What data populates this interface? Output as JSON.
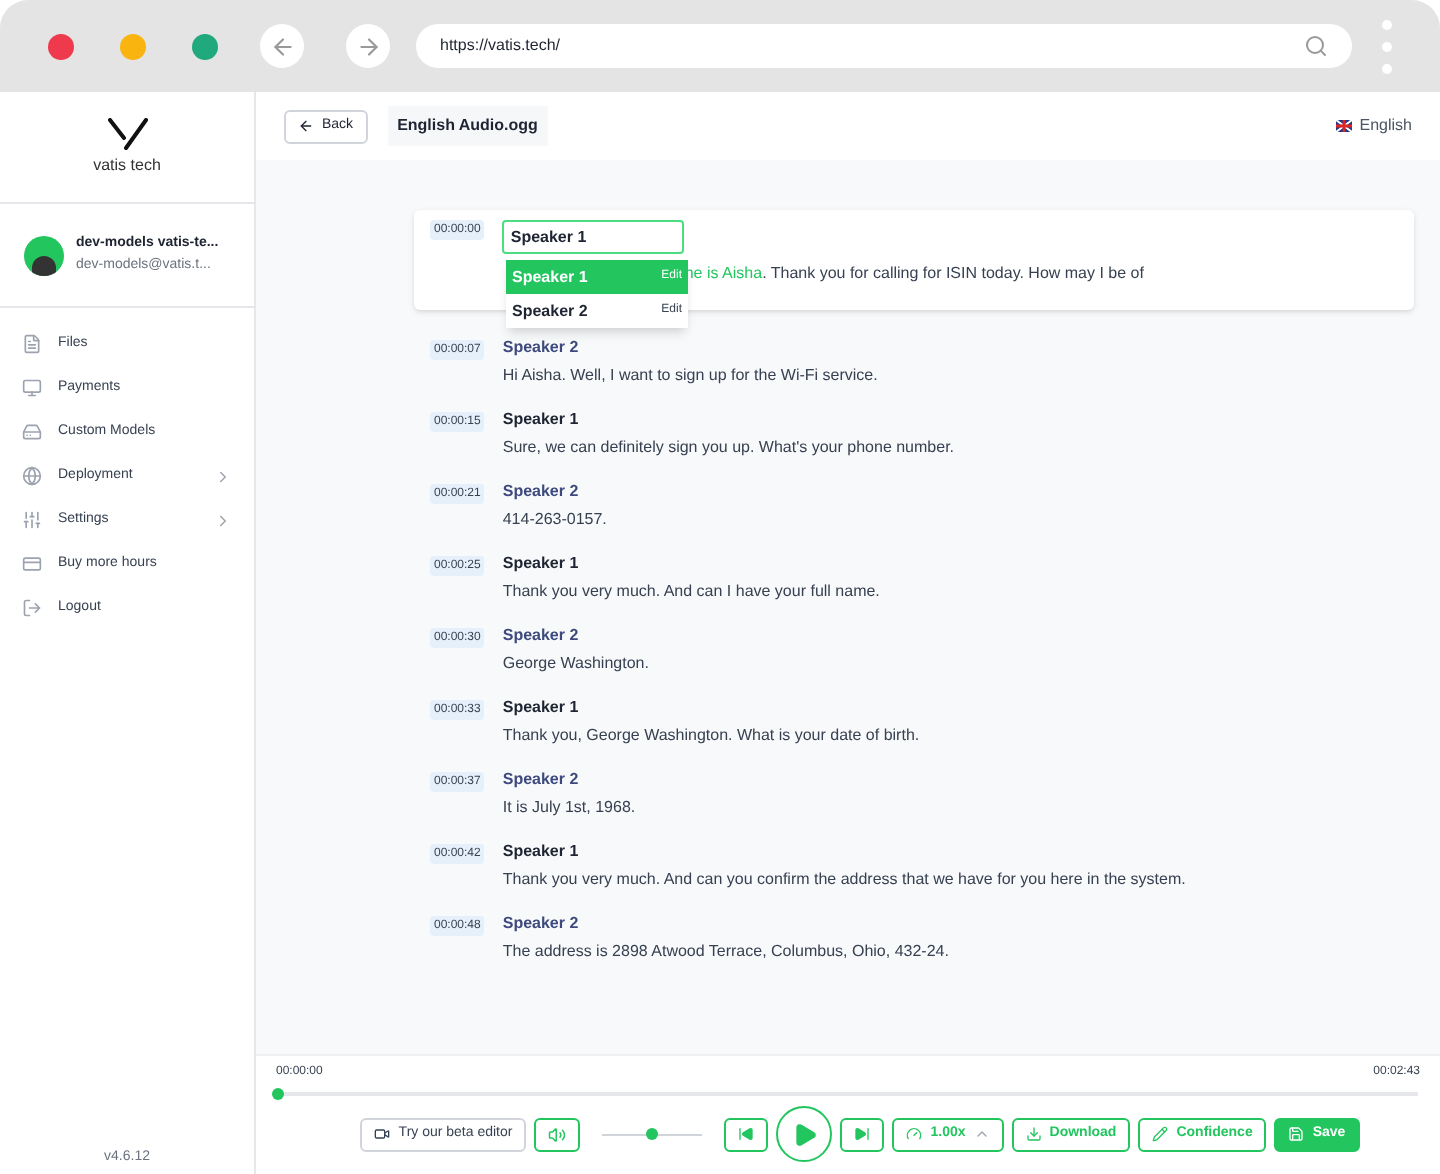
{
  "browser": {
    "url": "https://vatis.tech/"
  },
  "sidebar": {
    "logo_text": "vatis tech",
    "user": {
      "name": "dev-models vatis-te...",
      "email": "dev-models@vatis.t..."
    },
    "items": [
      {
        "label": "Files",
        "has_submenu": false
      },
      {
        "label": "Payments",
        "has_submenu": false
      },
      {
        "label": "Custom Models",
        "has_submenu": false
      },
      {
        "label": "Deployment",
        "has_submenu": true
      },
      {
        "label": "Settings",
        "has_submenu": true
      },
      {
        "label": "Buy more hours",
        "has_submenu": false
      },
      {
        "label": "Logout",
        "has_submenu": false
      }
    ],
    "version": "v4.6.12"
  },
  "header": {
    "back": "Back",
    "file_name": "English Audio.ogg",
    "language": "English"
  },
  "editing_segment": {
    "time": "00:00:00",
    "speaker_input": "Speaker 1",
    "highlighted_text": "ne is Aisha",
    "text": ". Thank you for calling for ISIN today. How may I be of",
    "speaker_options": [
      {
        "label": "Speaker 1",
        "action": "Edit",
        "selected": true
      },
      {
        "label": "Speaker 2",
        "action": "Edit",
        "selected": false
      }
    ]
  },
  "segments": [
    {
      "time": "00:00:07",
      "speaker": "Speaker 2",
      "color": "#3d4a7e",
      "text": "Hi Aisha. Well, I want to sign up for the Wi-Fi service."
    },
    {
      "time": "00:00:15",
      "speaker": "Speaker 1",
      "color": "#1f2433",
      "text": "Sure, we can definitely sign you up. What's your phone number."
    },
    {
      "time": "00:00:21",
      "speaker": "Speaker 2",
      "color": "#3d4a7e",
      "text": "414-263-0157."
    },
    {
      "time": "00:00:25",
      "speaker": "Speaker 1",
      "color": "#1f2433",
      "text": "Thank you very much. And can I have your full name."
    },
    {
      "time": "00:00:30",
      "speaker": "Speaker 2",
      "color": "#3d4a7e",
      "text": "George Washington."
    },
    {
      "time": "00:00:33",
      "speaker": "Speaker 1",
      "color": "#1f2433",
      "text": "Thank you, George Washington. What is your date of birth."
    },
    {
      "time": "00:00:37",
      "speaker": "Speaker 2",
      "color": "#3d4a7e",
      "text": "It is July 1st, 1968."
    },
    {
      "time": "00:00:42",
      "speaker": "Speaker 1",
      "color": "#1f2433",
      "text": "Thank you very much. And can you confirm the address that we have for you here in the system."
    },
    {
      "time": "00:00:48",
      "speaker": "Speaker 2",
      "color": "#3d4a7e",
      "text": "The address is 2898 Atwood Terrace, Columbus, Ohio, 432-24."
    }
  ],
  "player": {
    "current_time": "00:00:00",
    "total_time": "00:02:43",
    "progress": {
      "level": 0
    },
    "volume": {
      "level": 0.5
    },
    "beta_editor": "Try our beta editor",
    "speed": "1.00x",
    "download": "Download",
    "confidence": "Confidence",
    "save": "Save"
  }
}
